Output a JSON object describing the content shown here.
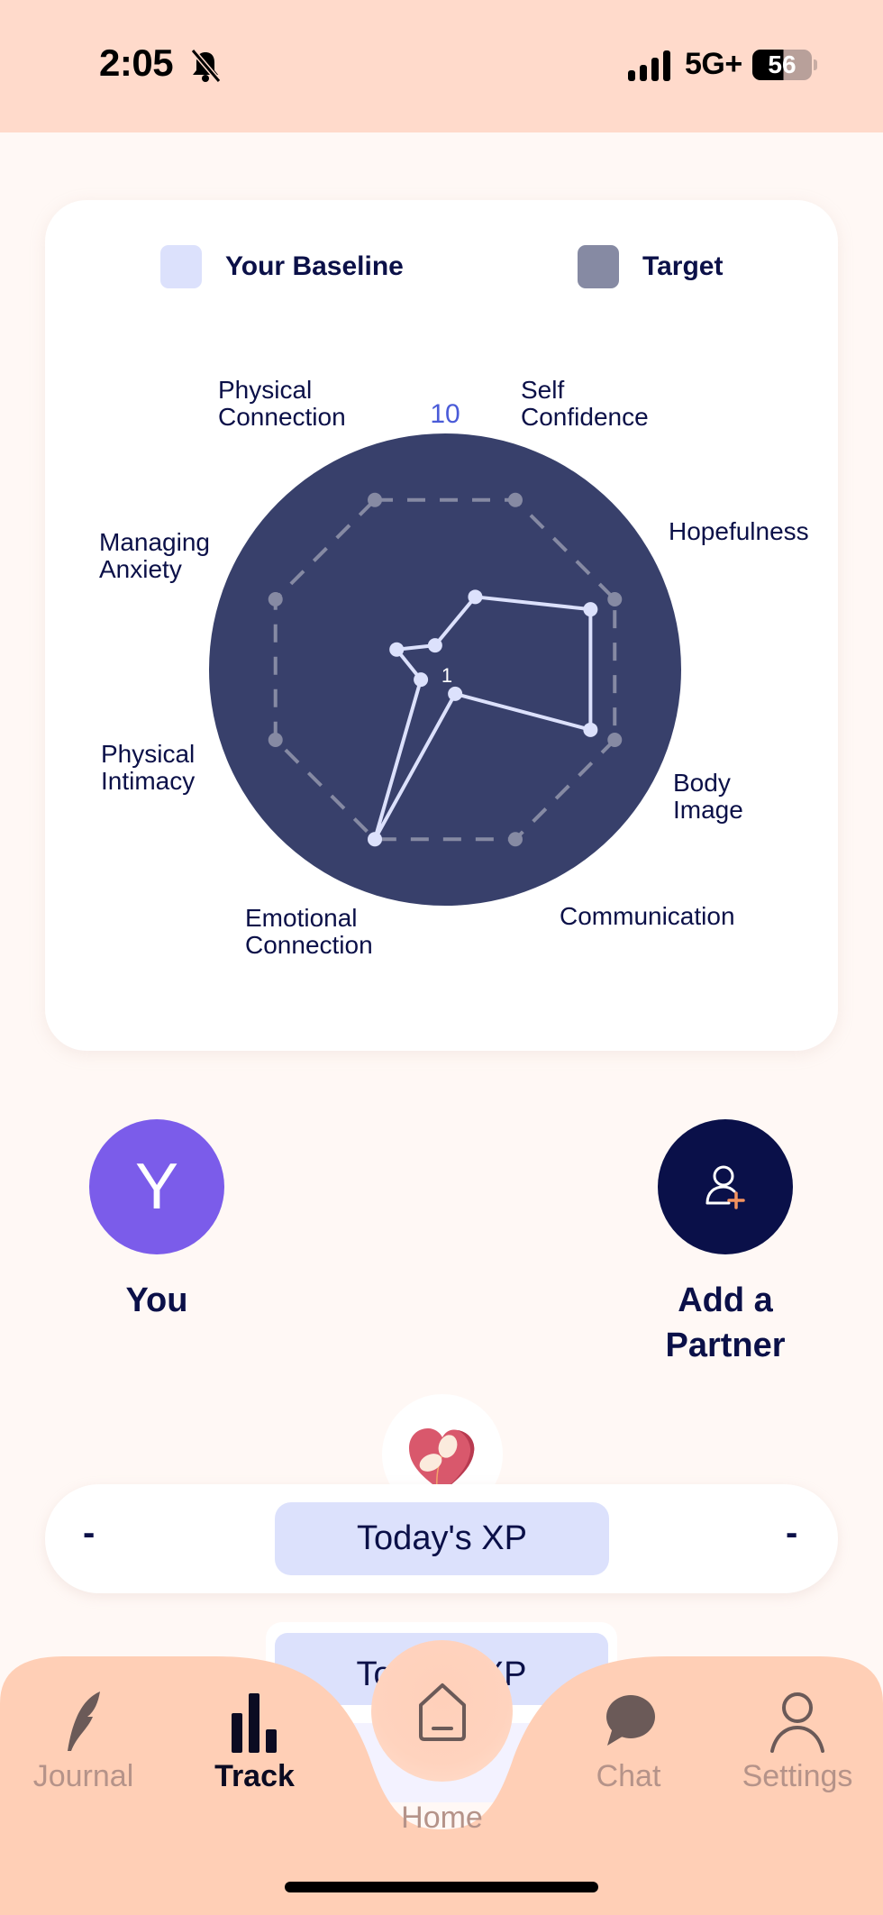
{
  "status_bar": {
    "time": "2:05",
    "silent_icon": "bell-slash-icon",
    "signal_icon": "cellular-signal-icon",
    "network": "5G+",
    "battery": "56"
  },
  "legend": {
    "baseline_label": "Your Baseline",
    "target_label": "Target",
    "baseline_color": "#DCE1FC",
    "target_color": "#868AA3"
  },
  "chart_data": {
    "type": "radar",
    "axes": [
      "Physical Connection",
      "Self Confidence",
      "Hopefulness",
      "Body Image",
      "Communication",
      "Emotional Connection",
      "Physical Intimacy",
      "Managing Anxiety"
    ],
    "axis_labels_lines": [
      [
        "Physical",
        "Connection"
      ],
      [
        "Self",
        "Confidence"
      ],
      [
        "Hopefulness"
      ],
      [
        "Body",
        "Image"
      ],
      [
        "Communication"
      ],
      [
        "Emotional",
        "Connection"
      ],
      [
        "Physical",
        "Intimacy"
      ],
      [
        "Managing",
        "Anxiety"
      ]
    ],
    "range": [
      1,
      10
    ],
    "tick_labels": {
      "max": "10",
      "min": "1"
    },
    "series": [
      {
        "name": "Your Baseline",
        "values": [
          2,
          4,
          7,
          7,
          2,
          8,
          2,
          3
        ],
        "color": "#DCE1FC",
        "style": "solid"
      },
      {
        "name": "Target",
        "values": [
          8,
          8,
          8,
          8,
          8,
          8,
          8,
          8
        ],
        "color": "#868AA3",
        "style": "dashed"
      }
    ],
    "background_color": "#38406B"
  },
  "people": {
    "you": {
      "initial": "Y",
      "label": "You",
      "color": "#7B5CEA"
    },
    "partner": {
      "label_line1": "Add a",
      "label_line2": "Partner",
      "icon": "add-user-icon",
      "color": "#0A1049"
    }
  },
  "xp": {
    "label": "Today's XP",
    "left_value": "-",
    "right_value": "-",
    "mascot_icon": "heart-sprout-icon"
  },
  "nav": {
    "items": [
      {
        "label": "Journal",
        "icon": "quill-icon",
        "active": false
      },
      {
        "label": "Track",
        "icon": "bar-chart-icon",
        "active": true
      },
      {
        "label": "Home",
        "icon": "home-icon",
        "active": false
      },
      {
        "label": "Chat",
        "icon": "chat-bubble-icon",
        "active": false
      },
      {
        "label": "Settings",
        "icon": "person-icon",
        "active": false
      }
    ]
  }
}
